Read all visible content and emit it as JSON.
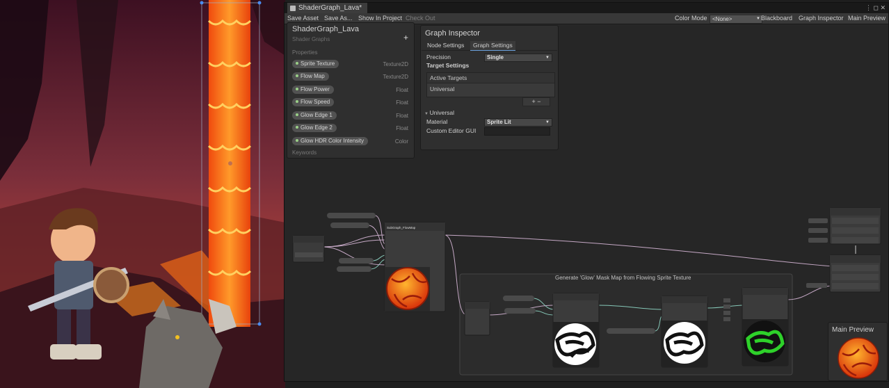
{
  "window": {
    "tab_title": "ShaderGraph_Lava*",
    "controls": "⋮ ◻ ✕"
  },
  "toolbar": {
    "save_asset": "Save Asset",
    "save_as": "Save As...",
    "show_in_project": "Show In Project",
    "check_out": "Check Out",
    "color_mode_label": "Color Mode",
    "color_mode_value": "<None>",
    "blackboard": "Blackboard",
    "graph_inspector": "Graph Inspector",
    "main_preview": "Main Preview"
  },
  "blackboard": {
    "title": "ShaderGraph_Lava",
    "subtitle": "Shader Graphs",
    "add": "+",
    "properties_header": "Properties",
    "keywords_header": "Keywords",
    "properties": [
      {
        "name": "Sprite Texture",
        "type": "Texture2D"
      },
      {
        "name": "Flow Map",
        "type": "Texture2D"
      },
      {
        "name": "Flow Power",
        "type": "Float"
      },
      {
        "name": "Flow Speed",
        "type": "Float"
      },
      {
        "name": "Glow Edge 1",
        "type": "Float"
      },
      {
        "name": "Glow Edge 2",
        "type": "Float"
      },
      {
        "name": "Glow HDR Color Intensity",
        "type": "Color"
      }
    ]
  },
  "graph_inspector": {
    "title": "Graph Inspector",
    "tabs": [
      "Node Settings",
      "Graph Settings"
    ],
    "precision_label": "Precision",
    "precision_value": "Single",
    "target_settings": "Target Settings",
    "active_targets": "Active Targets",
    "target_item": "Universal",
    "add_remove": "+  −",
    "universal_section": "Universal",
    "material_label": "Material",
    "material_value": "Sprite Lit",
    "custom_editor_label": "Custom Editor GUI"
  },
  "graph": {
    "group_title": "Generate 'Glow' Mask Map from Flowing Sprite Texture",
    "subgraph_title": "SubGraph_FlowMap"
  },
  "main_preview": {
    "title": "Main Preview"
  },
  "colors": {
    "accent": "#6aa0dc",
    "lava_orange": "#f36a10",
    "glow_green": "#2ed12a"
  }
}
